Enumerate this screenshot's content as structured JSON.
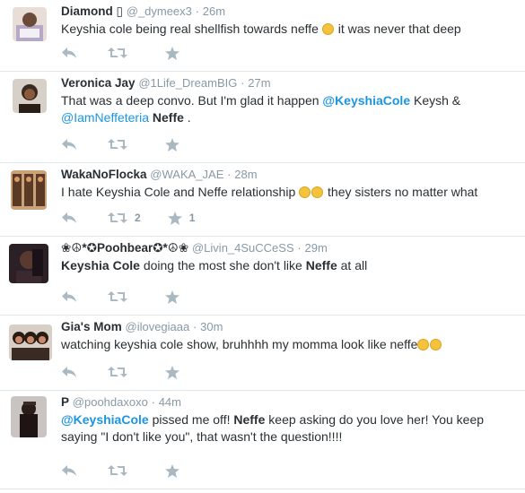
{
  "tweets": [
    {
      "name": "Diamond ",
      "handle": "@_dymeex3",
      "sep": "·",
      "time": "26m",
      "text": "Keyshia cole being real shellfish towards neffe ",
      "text_tail": " it was never that deep",
      "emoji": "confused-face",
      "retweets": "",
      "favorites": ""
    },
    {
      "name": "Veronica Jay",
      "handle": "@1Life_DreamBIG",
      "sep": "·",
      "time": "27m",
      "text_part1": "That was a deep convo. But I'm glad it happen ",
      "mention1": "@KeyshiaCole",
      "text_part2": " Keysh & ",
      "mention2": "@IamNeffeteria",
      "bold1": "Neffe",
      "text_part3": " .",
      "retweets": "",
      "favorites": ""
    },
    {
      "name": "WakaNoFlocka",
      "handle": "@WAKA_JAE",
      "sep": "·",
      "time": "28m",
      "text_part1": "I hate Keyshia Cole and Neffe relationship ",
      "text_part2": " they sisters no matter what",
      "emoji": "grimacing-face, unamused-face",
      "retweets": "2",
      "favorites": "1"
    },
    {
      "name": "❀☮*✪Poohbear✪*☮❀",
      "handle": "@Livin_4SuCCeSS",
      "sep": "·",
      "time": "29m",
      "bold1": "Keyshia Cole",
      "text_part1": " doing the most she don't like ",
      "bold2": "Neffe",
      "text_part2": " at all",
      "retweets": "",
      "favorites": ""
    },
    {
      "name": "Gia's Mom",
      "handle": "@ilovegiaaa",
      "sep": "·",
      "time": "30m",
      "text": "watching keyshia cole show, bruhhhh my momma look like neffe",
      "emoji": "joy-face, joy-face",
      "retweets": "",
      "favorites": ""
    },
    {
      "name": "P",
      "handle": "@poohdaxoxo",
      "sep": "·",
      "time": "44m",
      "mention1": "@KeyshiaCole",
      "text_part1": " pissed me off! ",
      "bold1": "Neffe",
      "text_part2": " keep asking do you love her! You keep saying \"I don't like you\", that wasn't the question!!!!",
      "retweets": "",
      "favorites": ""
    }
  ],
  "icons": {
    "reply": "reply-icon",
    "retweet": "retweet-icon",
    "favorite": "star-icon"
  },
  "colors": {
    "link": "#1b95e0",
    "meta": "#8899a6",
    "icon": "#aab8c2",
    "text": "#292f33"
  }
}
